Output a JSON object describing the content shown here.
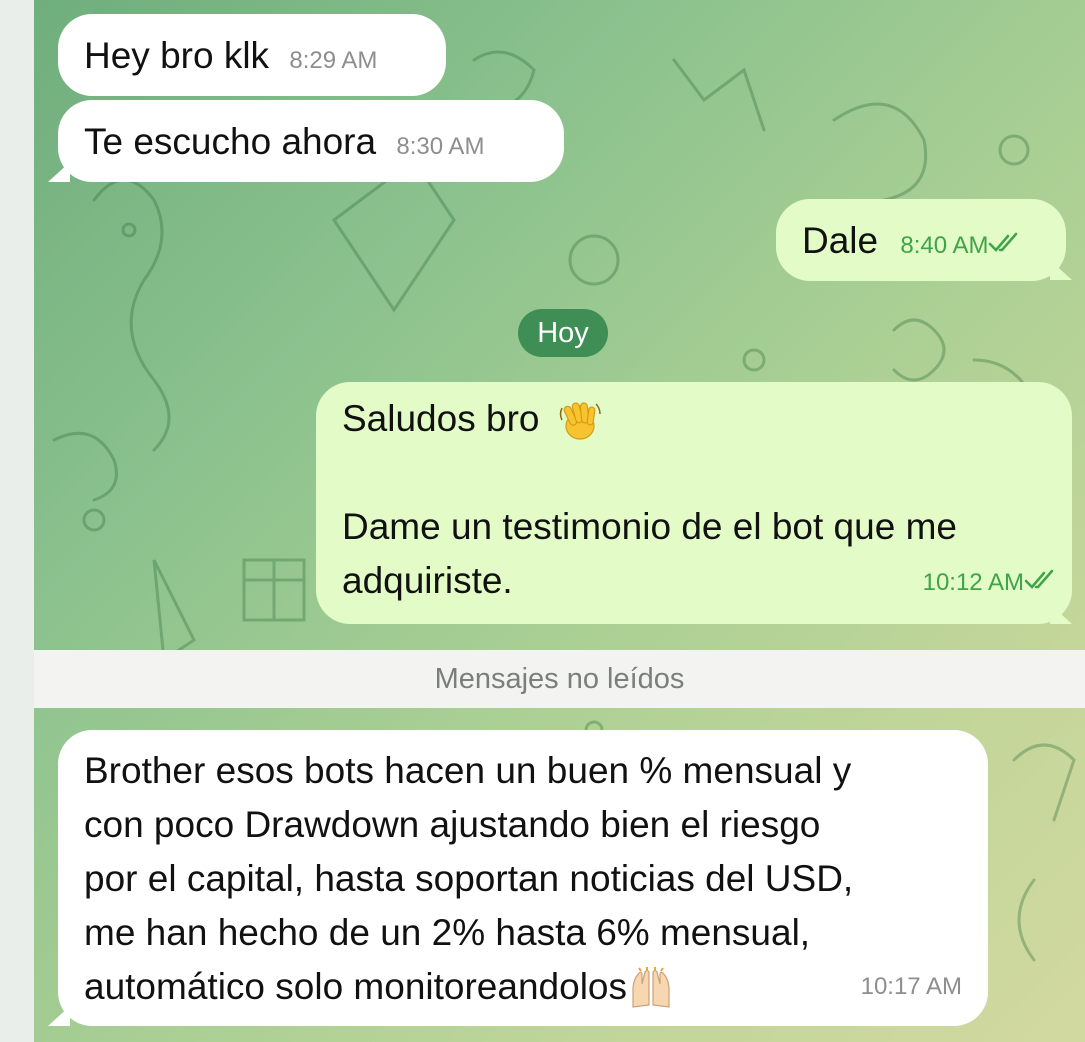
{
  "messages": [
    {
      "direction": "in",
      "text": "Hey bro klk",
      "time": "8:29 AM"
    },
    {
      "direction": "in",
      "text": "Te escucho ahora",
      "time": "8:30 AM"
    },
    {
      "direction": "out",
      "text": "Dale",
      "time": "8:40 AM",
      "status": "read"
    },
    {
      "direction": "out",
      "lines": [
        "Saludos bro",
        "",
        "Dame un testimonio de el bot que me",
        "adquiriste."
      ],
      "emoji": "waving-hand",
      "time": "10:12 AM",
      "status": "read"
    },
    {
      "direction": "in",
      "lines": [
        "Brother esos bots hacen un buen % mensual y",
        "con poco Drawdown ajustando bien el riesgo",
        "por el capital, hasta soportan noticias del USD,",
        "me han hecho de un 2% hasta 6% mensual,",
        "automático solo monitoreandolos"
      ],
      "emoji": "raising-hands",
      "time": "10:17 AM"
    }
  ],
  "date_separator": "Hoy",
  "unread_separator": "Mensajes no leídos",
  "colors": {
    "incoming_bubble": "#ffffff",
    "outgoing_bubble": "#e2fbc7",
    "date_pill": "#3e8e55",
    "read_check": "#3fa34a"
  }
}
